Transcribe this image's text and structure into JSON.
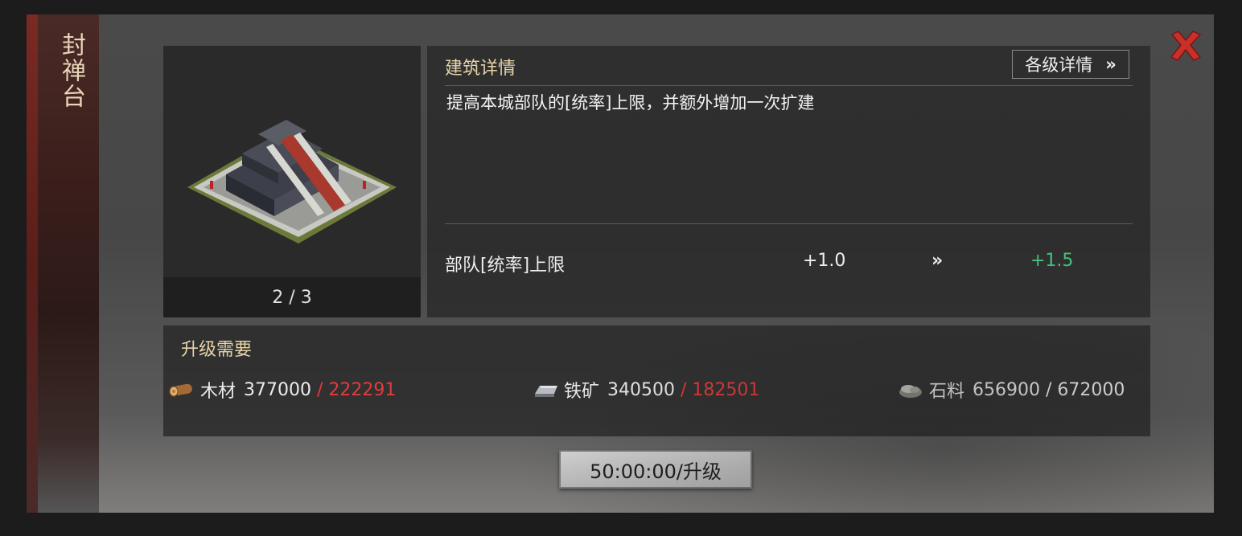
{
  "sidebar": {
    "title": "封禅台"
  },
  "building_image": {
    "page_indicator": "2 / 3"
  },
  "details": {
    "title": "建筑详情",
    "levels_button": "各级详情",
    "levels_button_icon": "double-chevron-right-icon",
    "description": "提高本城部队的[统率]上限，并额外增加一次扩建",
    "stat": {
      "label": "部队[统率]上限",
      "current": "+1.0",
      "arrow": "»",
      "next": "+1.5"
    }
  },
  "requirements": {
    "title": "升级需要",
    "resources": [
      {
        "icon": "wood-log-icon",
        "name": "木材",
        "owned": "377000",
        "separator": " / ",
        "required": "222291"
      },
      {
        "icon": "iron-ingot-icon",
        "name": "铁矿",
        "owned": "340500",
        "separator": " / ",
        "required": "182501"
      },
      {
        "icon": "stone-icon",
        "name": "石料",
        "owned": "656900",
        "separator": " / ",
        "required": "672000"
      }
    ]
  },
  "upgrade_button": {
    "label": "50:00:00/升级"
  },
  "colors": {
    "accent_title": "#e6d3a8",
    "insufficient": "#e23b3b",
    "increase": "#43c27a",
    "close": "#c8302a"
  }
}
